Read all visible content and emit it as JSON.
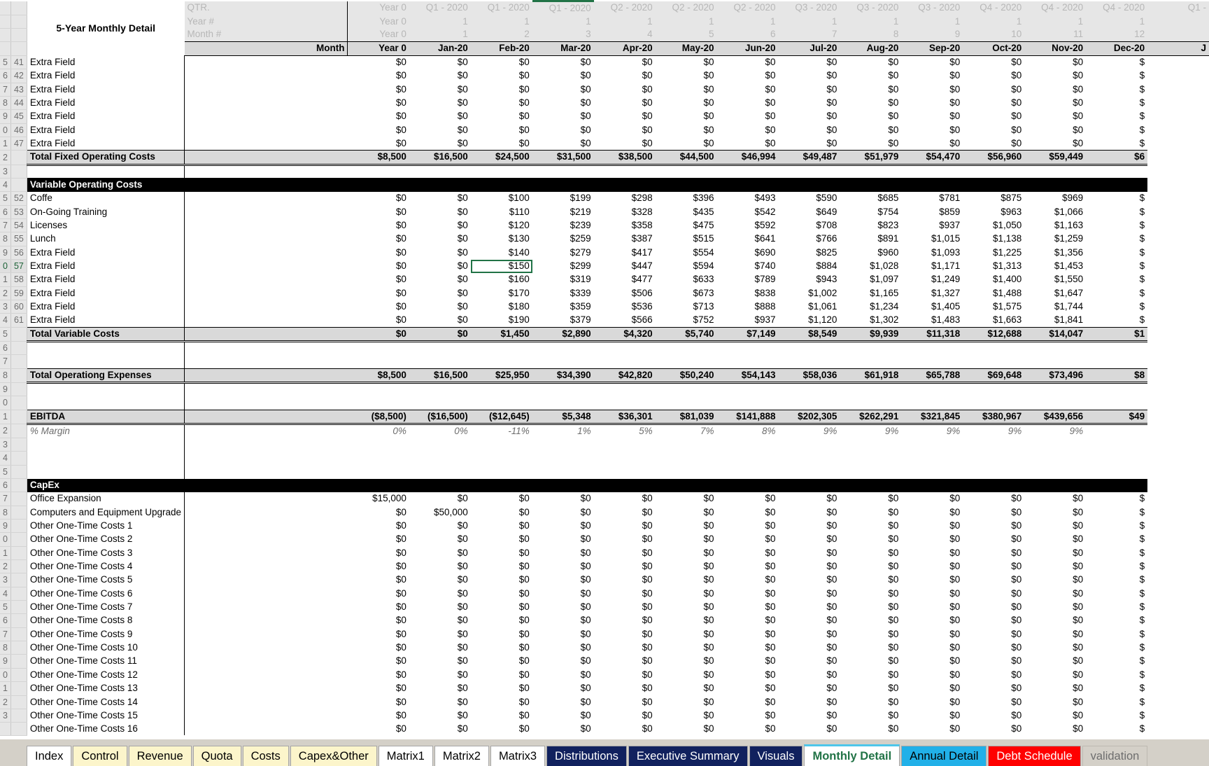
{
  "sheet": {
    "title": "5-Year Monthly Detail",
    "corner_labels": [
      "QTR.",
      "Year #",
      "Month #"
    ],
    "year0_label": "Year 0",
    "month_header_label": "Month",
    "quarters": [
      "Year 0",
      "Q1 - 2020",
      "Q1 - 2020",
      "Q1 - 2020",
      "Q2 - 2020",
      "Q2 - 2020",
      "Q2 - 2020",
      "Q3 - 2020",
      "Q3 - 2020",
      "Q3 - 2020",
      "Q4 - 2020",
      "Q4 - 2020",
      "Q4 - 2020",
      "Q1 -"
    ],
    "year_nums": [
      "Year 0",
      "1",
      "1",
      "1",
      "1",
      "1",
      "1",
      "1",
      "1",
      "1",
      "1",
      "1",
      "1",
      ""
    ],
    "month_nums": [
      "Year 0",
      "1",
      "2",
      "3",
      "4",
      "5",
      "6",
      "7",
      "8",
      "9",
      "10",
      "11",
      "12",
      ""
    ],
    "months": [
      "Year 0",
      "Jan-20",
      "Feb-20",
      "Mar-20",
      "Apr-20",
      "May-20",
      "Jun-20",
      "Jul-20",
      "Aug-20",
      "Sep-20",
      "Oct-20",
      "Nov-20",
      "Dec-20",
      "J"
    ],
    "selected_column_index": 3,
    "selected_row_number": "57"
  },
  "row_numbers": {
    "fixed_extra": [
      "41",
      "42",
      "43",
      "44",
      "45",
      "46",
      "47"
    ],
    "variable": [
      "52",
      "53",
      "54",
      "55",
      "56",
      "57",
      "58",
      "59",
      "60",
      "61"
    ]
  },
  "rows": [
    {
      "kind": "data",
      "rownum": "41",
      "label": "Extra Field",
      "values": [
        "",
        "$0",
        "$0",
        "$0",
        "$0",
        "$0",
        "$0",
        "$0",
        "$0",
        "$0",
        "$0",
        "$0",
        "$0",
        "$"
      ]
    },
    {
      "kind": "data",
      "rownum": "42",
      "label": "Extra Field",
      "values": [
        "",
        "$0",
        "$0",
        "$0",
        "$0",
        "$0",
        "$0",
        "$0",
        "$0",
        "$0",
        "$0",
        "$0",
        "$0",
        "$"
      ]
    },
    {
      "kind": "data",
      "rownum": "43",
      "label": "Extra Field",
      "values": [
        "",
        "$0",
        "$0",
        "$0",
        "$0",
        "$0",
        "$0",
        "$0",
        "$0",
        "$0",
        "$0",
        "$0",
        "$0",
        "$"
      ]
    },
    {
      "kind": "data",
      "rownum": "44",
      "label": "Extra Field",
      "values": [
        "",
        "$0",
        "$0",
        "$0",
        "$0",
        "$0",
        "$0",
        "$0",
        "$0",
        "$0",
        "$0",
        "$0",
        "$0",
        "$"
      ]
    },
    {
      "kind": "data",
      "rownum": "45",
      "label": "Extra Field",
      "values": [
        "",
        "$0",
        "$0",
        "$0",
        "$0",
        "$0",
        "$0",
        "$0",
        "$0",
        "$0",
        "$0",
        "$0",
        "$0",
        "$"
      ]
    },
    {
      "kind": "data",
      "rownum": "46",
      "label": "Extra Field",
      "values": [
        "",
        "$0",
        "$0",
        "$0",
        "$0",
        "$0",
        "$0",
        "$0",
        "$0",
        "$0",
        "$0",
        "$0",
        "$0",
        "$"
      ]
    },
    {
      "kind": "data",
      "rownum": "47",
      "label": "Extra Field",
      "values": [
        "",
        "$0",
        "$0",
        "$0",
        "$0",
        "$0",
        "$0",
        "$0",
        "$0",
        "$0",
        "$0",
        "$0",
        "$0",
        "$"
      ]
    },
    {
      "kind": "total",
      "rownum": "",
      "label": "Total Fixed Operating Costs",
      "values": [
        "",
        "$8,500",
        "$16,500",
        "$24,500",
        "$31,500",
        "$38,500",
        "$44,500",
        "$46,994",
        "$49,487",
        "$51,979",
        "$54,470",
        "$56,960",
        "$59,449",
        "$6"
      ]
    },
    {
      "kind": "spacer",
      "rownum": "",
      "label": "",
      "values": [
        "",
        "",
        "",
        "",
        "",
        "",
        "",
        "",
        "",
        "",
        "",
        "",
        "",
        ""
      ]
    },
    {
      "kind": "section",
      "rownum": "",
      "label": "Variable Operating Costs",
      "values": [
        "",
        "",
        "",
        "",
        "",
        "",
        "",
        "",
        "",
        "",
        "",
        "",
        "",
        ""
      ]
    },
    {
      "kind": "data",
      "rownum": "52",
      "label": "Coffe",
      "values": [
        "",
        "$0",
        "$0",
        "$100",
        "$199",
        "$298",
        "$396",
        "$493",
        "$590",
        "$685",
        "$781",
        "$875",
        "$969",
        "$"
      ]
    },
    {
      "kind": "data",
      "rownum": "53",
      "label": "On-Going Training",
      "values": [
        "",
        "$0",
        "$0",
        "$110",
        "$219",
        "$328",
        "$435",
        "$542",
        "$649",
        "$754",
        "$859",
        "$963",
        "$1,066",
        "$"
      ]
    },
    {
      "kind": "data",
      "rownum": "54",
      "label": "Licenses",
      "values": [
        "",
        "$0",
        "$0",
        "$120",
        "$239",
        "$358",
        "$475",
        "$592",
        "$708",
        "$823",
        "$937",
        "$1,050",
        "$1,163",
        "$"
      ]
    },
    {
      "kind": "data",
      "rownum": "55",
      "label": "Lunch",
      "values": [
        "",
        "$0",
        "$0",
        "$130",
        "$259",
        "$387",
        "$515",
        "$641",
        "$766",
        "$891",
        "$1,015",
        "$1,138",
        "$1,259",
        "$"
      ]
    },
    {
      "kind": "data",
      "rownum": "56",
      "label": "Extra Field",
      "values": [
        "",
        "$0",
        "$0",
        "$140",
        "$279",
        "$417",
        "$554",
        "$690",
        "$825",
        "$960",
        "$1,093",
        "$1,225",
        "$1,356",
        "$"
      ]
    },
    {
      "kind": "data",
      "rownum": "57",
      "label": "Extra Field",
      "selected": true,
      "values": [
        "",
        "$0",
        "$0",
        "$150",
        "$299",
        "$447",
        "$594",
        "$740",
        "$884",
        "$1,028",
        "$1,171",
        "$1,313",
        "$1,453",
        "$"
      ]
    },
    {
      "kind": "data",
      "rownum": "58",
      "label": "Extra Field",
      "values": [
        "",
        "$0",
        "$0",
        "$160",
        "$319",
        "$477",
        "$633",
        "$789",
        "$943",
        "$1,097",
        "$1,249",
        "$1,400",
        "$1,550",
        "$"
      ]
    },
    {
      "kind": "data",
      "rownum": "59",
      "label": "Extra Field",
      "values": [
        "",
        "$0",
        "$0",
        "$170",
        "$339",
        "$506",
        "$673",
        "$838",
        "$1,002",
        "$1,165",
        "$1,327",
        "$1,488",
        "$1,647",
        "$"
      ]
    },
    {
      "kind": "data",
      "rownum": "60",
      "label": "Extra Field",
      "values": [
        "",
        "$0",
        "$0",
        "$180",
        "$359",
        "$536",
        "$713",
        "$888",
        "$1,061",
        "$1,234",
        "$1,405",
        "$1,575",
        "$1,744",
        "$"
      ]
    },
    {
      "kind": "data",
      "rownum": "61",
      "label": "Extra Field",
      "values": [
        "",
        "$0",
        "$0",
        "$190",
        "$379",
        "$566",
        "$752",
        "$937",
        "$1,120",
        "$1,302",
        "$1,483",
        "$1,663",
        "$1,841",
        "$"
      ]
    },
    {
      "kind": "total",
      "rownum": "",
      "label": "Total Variable Costs",
      "values": [
        "",
        "$0",
        "$0",
        "$1,450",
        "$2,890",
        "$4,320",
        "$5,740",
        "$7,149",
        "$8,549",
        "$9,939",
        "$11,318",
        "$12,688",
        "$14,047",
        "$1"
      ]
    },
    {
      "kind": "spacer",
      "rownum": "",
      "label": "",
      "values": [
        "",
        "",
        "",
        "",
        "",
        "",
        "",
        "",
        "",
        "",
        "",
        "",
        "",
        ""
      ]
    },
    {
      "kind": "spacer",
      "rownum": "",
      "label": "",
      "values": [
        "",
        "",
        "",
        "",
        "",
        "",
        "",
        "",
        "",
        "",
        "",
        "",
        "",
        ""
      ]
    },
    {
      "kind": "total",
      "rownum": "",
      "label": "Total Operationg Expenses",
      "values": [
        "",
        "$8,500",
        "$16,500",
        "$25,950",
        "$34,390",
        "$42,820",
        "$50,240",
        "$54,143",
        "$58,036",
        "$61,918",
        "$65,788",
        "$69,648",
        "$73,496",
        "$8"
      ]
    },
    {
      "kind": "spacer",
      "rownum": "",
      "label": "",
      "values": [
        "",
        "",
        "",
        "",
        "",
        "",
        "",
        "",
        "",
        "",
        "",
        "",
        "",
        ""
      ]
    },
    {
      "kind": "spacer",
      "rownum": "",
      "label": "",
      "values": [
        "",
        "",
        "",
        "",
        "",
        "",
        "",
        "",
        "",
        "",
        "",
        "",
        "",
        ""
      ]
    },
    {
      "kind": "total",
      "rownum": "",
      "label": "EBITDA",
      "values": [
        "",
        "($8,500)",
        "($16,500)",
        "($12,645)",
        "$5,348",
        "$36,301",
        "$81,039",
        "$141,888",
        "$202,305",
        "$262,291",
        "$321,845",
        "$380,967",
        "$439,656",
        "$49"
      ]
    },
    {
      "kind": "margin",
      "rownum": "",
      "label": "% Margin",
      "values": [
        "",
        "0%",
        "0%",
        "-11%",
        "1%",
        "5%",
        "7%",
        "8%",
        "9%",
        "9%",
        "9%",
        "9%",
        "9%",
        ""
      ]
    },
    {
      "kind": "spacer",
      "rownum": "",
      "label": "",
      "values": [
        "",
        "",
        "",
        "",
        "",
        "",
        "",
        "",
        "",
        "",
        "",
        "",
        "",
        ""
      ]
    },
    {
      "kind": "spacer",
      "rownum": "",
      "label": "",
      "values": [
        "",
        "",
        "",
        "",
        "",
        "",
        "",
        "",
        "",
        "",
        "",
        "",
        "",
        ""
      ]
    },
    {
      "kind": "spacer",
      "rownum": "",
      "label": "",
      "values": [
        "",
        "",
        "",
        "",
        "",
        "",
        "",
        "",
        "",
        "",
        "",
        "",
        "",
        ""
      ]
    },
    {
      "kind": "section",
      "rownum": "",
      "label": "CapEx",
      "values": [
        "",
        "",
        "",
        "",
        "",
        "",
        "",
        "",
        "",
        "",
        "",
        "",
        "",
        ""
      ]
    },
    {
      "kind": "data",
      "rownum": "",
      "label": "Office Expansion",
      "values": [
        "",
        "$15,000",
        "$0",
        "$0",
        "$0",
        "$0",
        "$0",
        "$0",
        "$0",
        "$0",
        "$0",
        "$0",
        "$0",
        "$"
      ]
    },
    {
      "kind": "data",
      "rownum": "",
      "label": "Computers and Equipment Upgrade",
      "values": [
        "",
        "$0",
        "$50,000",
        "$0",
        "$0",
        "$0",
        "$0",
        "$0",
        "$0",
        "$0",
        "$0",
        "$0",
        "$0",
        "$"
      ]
    },
    {
      "kind": "data",
      "rownum": "",
      "label": "Other One-Time Costs 1",
      "values": [
        "",
        "$0",
        "$0",
        "$0",
        "$0",
        "$0",
        "$0",
        "$0",
        "$0",
        "$0",
        "$0",
        "$0",
        "$0",
        "$"
      ]
    },
    {
      "kind": "data",
      "rownum": "",
      "label": "Other One-Time Costs 2",
      "values": [
        "",
        "$0",
        "$0",
        "$0",
        "$0",
        "$0",
        "$0",
        "$0",
        "$0",
        "$0",
        "$0",
        "$0",
        "$0",
        "$"
      ]
    },
    {
      "kind": "data",
      "rownum": "",
      "label": "Other One-Time Costs 3",
      "values": [
        "",
        "$0",
        "$0",
        "$0",
        "$0",
        "$0",
        "$0",
        "$0",
        "$0",
        "$0",
        "$0",
        "$0",
        "$0",
        "$"
      ]
    },
    {
      "kind": "data",
      "rownum": "",
      "label": "Other One-Time Costs 4",
      "values": [
        "",
        "$0",
        "$0",
        "$0",
        "$0",
        "$0",
        "$0",
        "$0",
        "$0",
        "$0",
        "$0",
        "$0",
        "$0",
        "$"
      ]
    },
    {
      "kind": "data",
      "rownum": "",
      "label": "Other One-Time Costs 5",
      "values": [
        "",
        "$0",
        "$0",
        "$0",
        "$0",
        "$0",
        "$0",
        "$0",
        "$0",
        "$0",
        "$0",
        "$0",
        "$0",
        "$"
      ]
    },
    {
      "kind": "data",
      "rownum": "",
      "label": "Other One-Time Costs 6",
      "values": [
        "",
        "$0",
        "$0",
        "$0",
        "$0",
        "$0",
        "$0",
        "$0",
        "$0",
        "$0",
        "$0",
        "$0",
        "$0",
        "$"
      ]
    },
    {
      "kind": "data",
      "rownum": "",
      "label": "Other One-Time Costs 7",
      "values": [
        "",
        "$0",
        "$0",
        "$0",
        "$0",
        "$0",
        "$0",
        "$0",
        "$0",
        "$0",
        "$0",
        "$0",
        "$0",
        "$"
      ]
    },
    {
      "kind": "data",
      "rownum": "",
      "label": "Other One-Time Costs 8",
      "values": [
        "",
        "$0",
        "$0",
        "$0",
        "$0",
        "$0",
        "$0",
        "$0",
        "$0",
        "$0",
        "$0",
        "$0",
        "$0",
        "$"
      ]
    },
    {
      "kind": "data",
      "rownum": "",
      "label": "Other One-Time Costs 9",
      "values": [
        "",
        "$0",
        "$0",
        "$0",
        "$0",
        "$0",
        "$0",
        "$0",
        "$0",
        "$0",
        "$0",
        "$0",
        "$0",
        "$"
      ]
    },
    {
      "kind": "data",
      "rownum": "",
      "label": "Other One-Time Costs 10",
      "values": [
        "",
        "$0",
        "$0",
        "$0",
        "$0",
        "$0",
        "$0",
        "$0",
        "$0",
        "$0",
        "$0",
        "$0",
        "$0",
        "$"
      ]
    },
    {
      "kind": "data",
      "rownum": "",
      "label": "Other One-Time Costs 11",
      "values": [
        "",
        "$0",
        "$0",
        "$0",
        "$0",
        "$0",
        "$0",
        "$0",
        "$0",
        "$0",
        "$0",
        "$0",
        "$0",
        "$"
      ]
    },
    {
      "kind": "data",
      "rownum": "",
      "label": "Other One-Time Costs 12",
      "values": [
        "",
        "$0",
        "$0",
        "$0",
        "$0",
        "$0",
        "$0",
        "$0",
        "$0",
        "$0",
        "$0",
        "$0",
        "$0",
        "$"
      ]
    },
    {
      "kind": "data",
      "rownum": "",
      "label": "Other One-Time Costs 13",
      "values": [
        "",
        "$0",
        "$0",
        "$0",
        "$0",
        "$0",
        "$0",
        "$0",
        "$0",
        "$0",
        "$0",
        "$0",
        "$0",
        "$"
      ]
    },
    {
      "kind": "data",
      "rownum": "",
      "label": "Other One-Time Costs 14",
      "values": [
        "",
        "$0",
        "$0",
        "$0",
        "$0",
        "$0",
        "$0",
        "$0",
        "$0",
        "$0",
        "$0",
        "$0",
        "$0",
        "$"
      ]
    },
    {
      "kind": "data",
      "rownum": "",
      "label": "Other One-Time Costs 15",
      "values": [
        "",
        "$0",
        "$0",
        "$0",
        "$0",
        "$0",
        "$0",
        "$0",
        "$0",
        "$0",
        "$0",
        "$0",
        "$0",
        "$"
      ]
    },
    {
      "kind": "data",
      "rownum": "",
      "label": "Other One-Time Costs 16",
      "values": [
        "",
        "$0",
        "$0",
        "$0",
        "$0",
        "$0",
        "$0",
        "$0",
        "$0",
        "$0",
        "$0",
        "$0",
        "$0",
        "$"
      ]
    }
  ],
  "tabs": [
    {
      "label": "Index",
      "bg": "#ffffff",
      "fg": "#000000",
      "active": false
    },
    {
      "label": "Control",
      "bg": "#fcf5cb",
      "fg": "#000000",
      "active": false
    },
    {
      "label": "Revenue",
      "bg": "#fcf5cb",
      "fg": "#000000",
      "active": false
    },
    {
      "label": "Quota",
      "bg": "#fcf5cb",
      "fg": "#000000",
      "active": false
    },
    {
      "label": "Costs",
      "bg": "#fcf5cb",
      "fg": "#000000",
      "active": false
    },
    {
      "label": "Capex&Other",
      "bg": "#fcf5cb",
      "fg": "#000000",
      "active": false
    },
    {
      "label": "Matrix1",
      "bg": "#ffffff",
      "fg": "#000000",
      "active": false
    },
    {
      "label": "Matrix2",
      "bg": "#ffffff",
      "fg": "#000000",
      "active": false
    },
    {
      "label": "Matrix3",
      "bg": "#ffffff",
      "fg": "#000000",
      "active": false
    },
    {
      "label": "Distributions",
      "bg": "#11215e",
      "fg": "#ffffff",
      "active": false
    },
    {
      "label": "Executive Summary",
      "bg": "#11215e",
      "fg": "#ffffff",
      "active": false
    },
    {
      "label": "Visuals",
      "bg": "#11215e",
      "fg": "#ffffff",
      "active": false
    },
    {
      "label": "Monthly Detail",
      "bg": "#ffffff",
      "fg": "#217346",
      "active": true
    },
    {
      "label": "Annual Detail",
      "bg": "#21b0e8",
      "fg": "#000000",
      "active": false
    },
    {
      "label": "Debt Schedule",
      "bg": "#ff0000",
      "fg": "#ffffff",
      "active": false
    },
    {
      "label": "validation",
      "bg": "#d4d0c8",
      "fg": "#6e6e6e",
      "active": false
    }
  ],
  "row_gutter_numbers": [
    "5",
    "6",
    "7",
    "8",
    "9",
    "0",
    "1",
    "2",
    "3",
    "4",
    "5",
    "6",
    "7",
    "8",
    "9",
    "0",
    "1",
    "2",
    "3",
    "4",
    "5",
    "6",
    "7",
    "8",
    "9",
    "0",
    "1",
    "2",
    "3",
    "4",
    "5",
    "6",
    "7",
    "8",
    "9",
    "0",
    "1",
    "2",
    "3",
    "4",
    "5",
    "6",
    "7",
    "8",
    "9",
    "0",
    "1",
    "2",
    "3"
  ]
}
